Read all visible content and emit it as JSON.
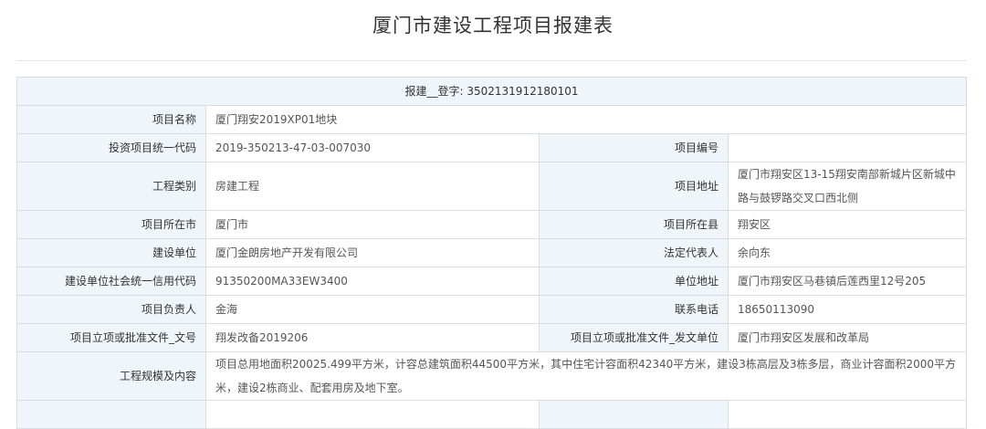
{
  "page_title": "厦门市建设工程项目报建表",
  "header": {
    "label": "报建__登字: ",
    "number": "3502131912180101"
  },
  "rows": {
    "project_name": {
      "label": "项目名称",
      "value": "厦门翔安2019XP01地块"
    },
    "invest_code": {
      "label": "投资项目统一代码",
      "value": "2019-350213-47-03-007030"
    },
    "project_no": {
      "label": "项目编号",
      "value": ""
    },
    "category": {
      "label": "工程类别",
      "value": "房建工程"
    },
    "address": {
      "label": "项目地址",
      "value": "厦门市翔安区13-15翔安南部新城片区新城中路与鼓锣路交叉口西北侧"
    },
    "city": {
      "label": "项目所在市",
      "value": "厦门市"
    },
    "county": {
      "label": "项目所在县",
      "value": "翔安区"
    },
    "builder": {
      "label": "建设单位",
      "value": "厦门金朗房地产开发有限公司"
    },
    "legal_rep": {
      "label": "法定代表人",
      "value": "余向东"
    },
    "credit_code": {
      "label": "建设单位社会统一信用代码",
      "value": "91350200MA33EW3400"
    },
    "unit_address": {
      "label": "单位地址",
      "value": "厦门市翔安区马巷镇后莲西里12号205"
    },
    "manager": {
      "label": "项目负责人",
      "value": "金海"
    },
    "phone": {
      "label": "联系电话",
      "value": "18650113090"
    },
    "approval_no": {
      "label": "项目立项或批准文件_文号",
      "value": "翔发改备2019206"
    },
    "approval_unit": {
      "label": "项目立项或批准文件_发文单位",
      "value": "厦门市翔安区发展和改革局"
    },
    "scope": {
      "label": "工程规模及内容",
      "value": "项目总用地面积20025.499平方米，计容总建筑面积44500平方米，其中住宅计容面积42340平方米，建设3栋高层及3栋多层，商业计容面积2000平方米，建设2栋商业、配套用房及地下室。"
    }
  }
}
